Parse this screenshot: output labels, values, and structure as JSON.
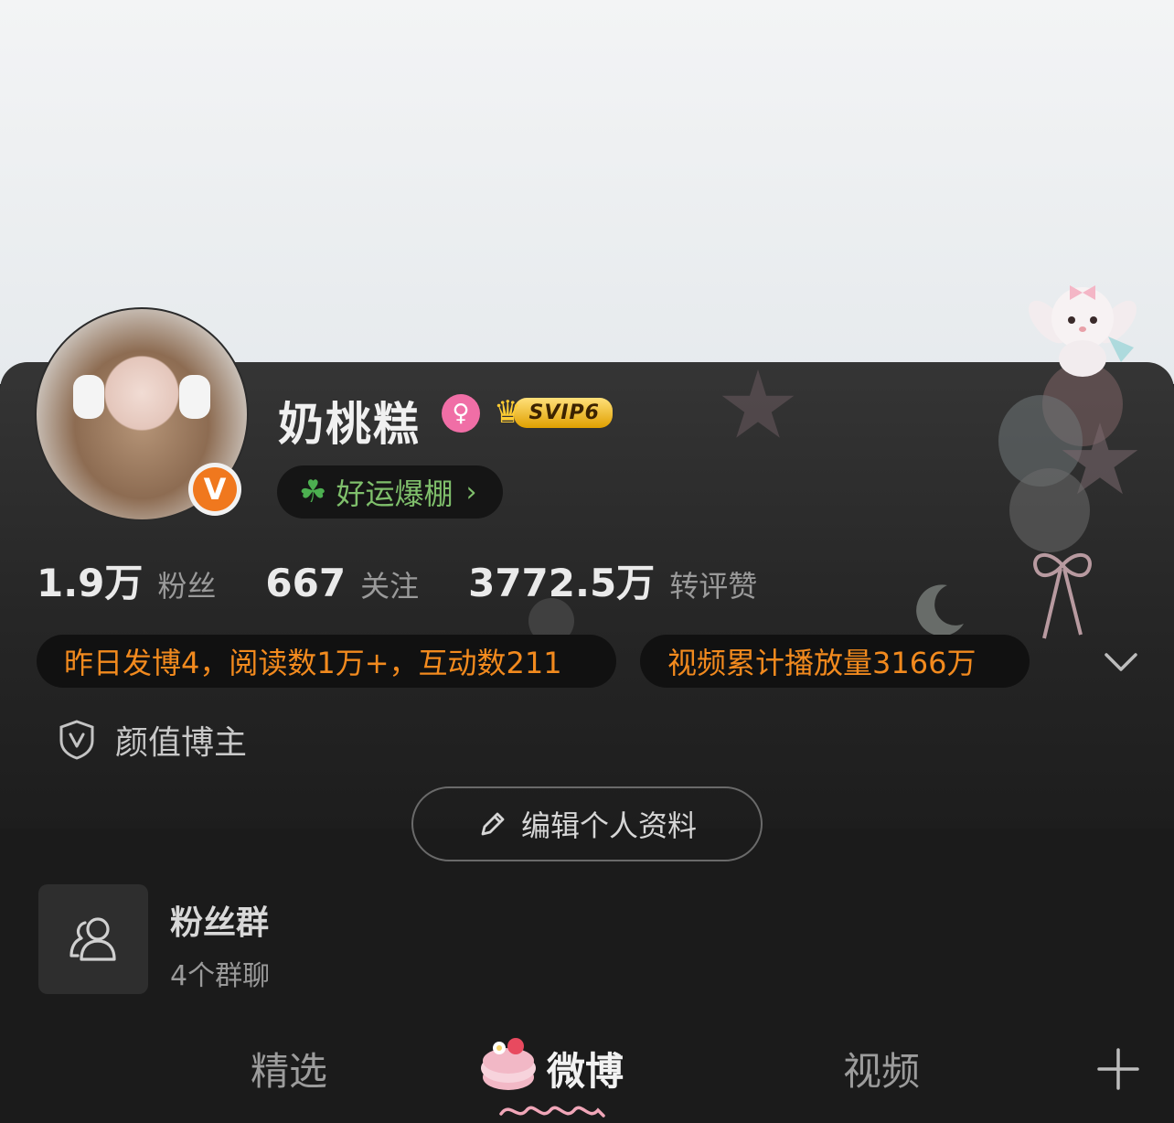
{
  "profile": {
    "name": "奶桃糕",
    "vip_label": "SVIP6",
    "luck_label": "好运爆棚",
    "verified_letter": "V"
  },
  "stats": [
    {
      "value": "1.9万",
      "label": "粉丝"
    },
    {
      "value": "667",
      "label": "关注"
    },
    {
      "value": "3772.5万",
      "label": "转评赞"
    }
  ],
  "highlights": {
    "daily": "昨日发博4，阅读数1万+，互动数211",
    "video": "视频累计播放量3166万"
  },
  "tag": {
    "label": "颜值博主"
  },
  "edit_button": {
    "label": "编辑个人资料"
  },
  "fan_group": {
    "title": "粉丝群",
    "subtitle": "4个群聊"
  },
  "tabs": [
    {
      "label": "精选",
      "active": false
    },
    {
      "label": "微博",
      "active": true
    },
    {
      "label": "视频",
      "active": false
    }
  ],
  "colors": {
    "accent_orange": "#f28a1e",
    "luck_green": "#7fbf6b",
    "gender_pink": "#f06ea6",
    "vip_gold": "#e0a000"
  },
  "icons": {
    "gender": "female-icon",
    "vip": "crown-icon",
    "luck": "clover-icon",
    "expand": "chevron-down-icon",
    "tag": "shield-v-icon",
    "edit": "pencil-icon",
    "group": "group-icon",
    "add": "plus-icon"
  }
}
